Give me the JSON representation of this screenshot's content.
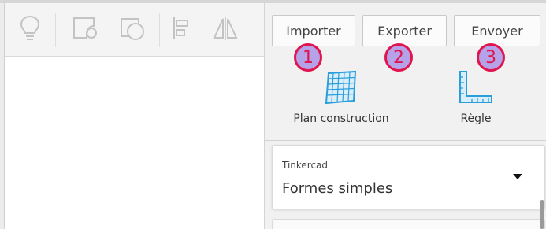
{
  "toolbar": {
    "tools": [
      {
        "icon": "lightbulb-icon"
      },
      {
        "icon": "note-shape-icon"
      },
      {
        "icon": "shape-group-icon"
      },
      {
        "icon": "align-icon"
      },
      {
        "icon": "mirror-icon"
      }
    ]
  },
  "actions": {
    "import_label": "Importer",
    "export_label": "Exporter",
    "send_label": "Envoyer"
  },
  "badges": [
    "1",
    "2",
    "3"
  ],
  "panel_tools": {
    "workplane_label": "Plan construction",
    "ruler_label": "Règle"
  },
  "shapes_select": {
    "category": "Tinkercad",
    "value": "Formes simples"
  },
  "colors": {
    "accent_icon": "#2a9ed8",
    "badge_fill": "#b5a2e8",
    "badge_border": "#e0154d"
  }
}
